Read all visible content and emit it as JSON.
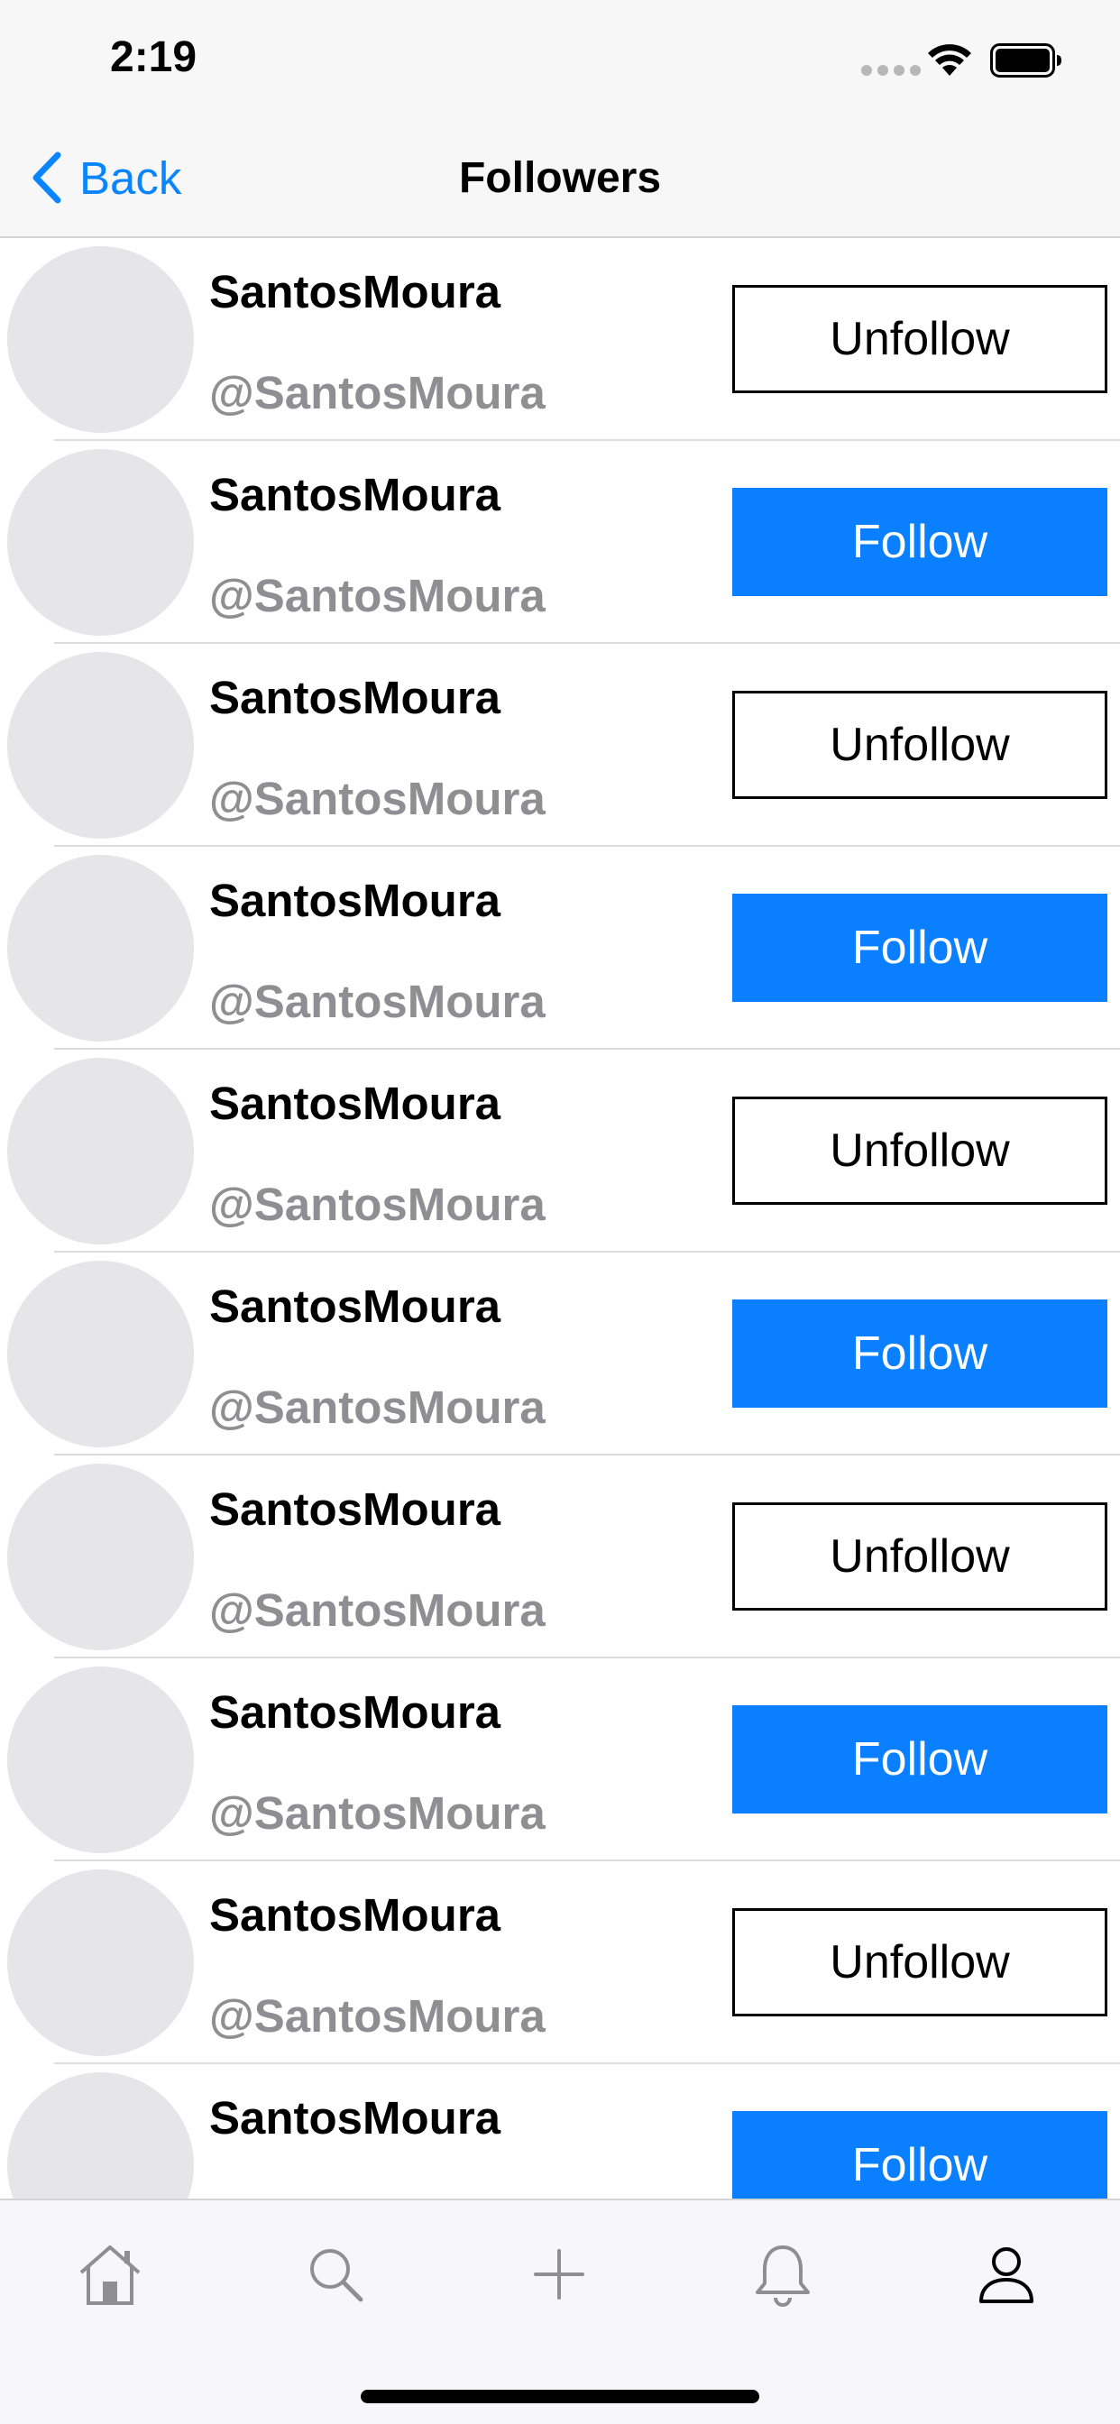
{
  "status_bar": {
    "time": "2:19"
  },
  "nav": {
    "back_label": "Back",
    "title": "Followers"
  },
  "followers": [
    {
      "name": "SantosMoura",
      "handle": "@SantosMoura",
      "button": "Unfollow",
      "following": true
    },
    {
      "name": "SantosMoura",
      "handle": "@SantosMoura",
      "button": "Follow",
      "following": false
    },
    {
      "name": "SantosMoura",
      "handle": "@SantosMoura",
      "button": "Unfollow",
      "following": true
    },
    {
      "name": "SantosMoura",
      "handle": "@SantosMoura",
      "button": "Follow",
      "following": false
    },
    {
      "name": "SantosMoura",
      "handle": "@SantosMoura",
      "button": "Unfollow",
      "following": true
    },
    {
      "name": "SantosMoura",
      "handle": "@SantosMoura",
      "button": "Follow",
      "following": false
    },
    {
      "name": "SantosMoura",
      "handle": "@SantosMoura",
      "button": "Unfollow",
      "following": true
    },
    {
      "name": "SantosMoura",
      "handle": "@SantosMoura",
      "button": "Follow",
      "following": false
    },
    {
      "name": "SantosMoura",
      "handle": "@SantosMoura",
      "button": "Unfollow",
      "following": true
    },
    {
      "name": "SantosMoura",
      "handle": "",
      "button": "Follow",
      "following": false
    }
  ],
  "tab_bar": {
    "tabs": [
      {
        "icon": "home-icon",
        "selected": false
      },
      {
        "icon": "search-icon",
        "selected": false
      },
      {
        "icon": "plus-icon",
        "selected": false
      },
      {
        "icon": "bell-icon",
        "selected": false
      },
      {
        "icon": "profile-icon",
        "selected": true
      }
    ]
  },
  "colors": {
    "accent": "#0a84ff",
    "follow_button": "#0a7fff",
    "secondary_text": "#8e8e93",
    "avatar_placeholder": "#e6e6e9",
    "tab_inactive": "#8e8e93",
    "tab_active": "#000000"
  }
}
